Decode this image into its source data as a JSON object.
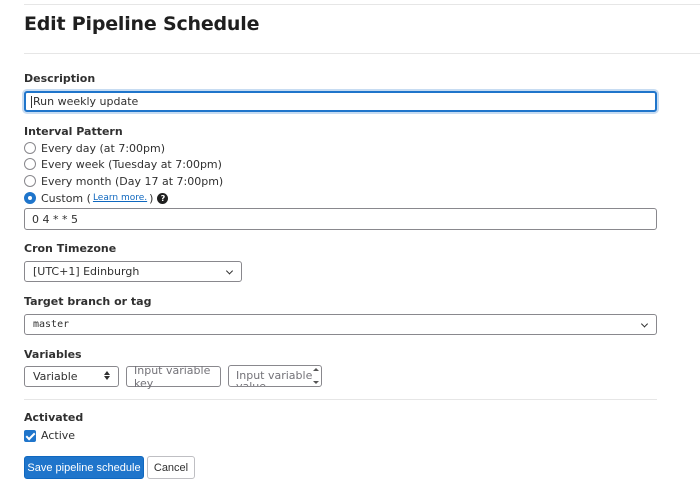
{
  "page": {
    "title": "Edit Pipeline Schedule"
  },
  "description": {
    "label": "Description",
    "value": "Run weekly update"
  },
  "interval": {
    "label": "Interval Pattern",
    "options": [
      {
        "label": "Every day (at 7:00pm)",
        "checked": false
      },
      {
        "label": "Every week (Tuesday at 7:00pm)",
        "checked": false
      },
      {
        "label": "Every month (Day 17 at 7:00pm)",
        "checked": false
      },
      {
        "label": "Custom (",
        "checked": true
      }
    ],
    "learn_more": "Learn more.",
    "custom_suffix": ")",
    "help_glyph": "?",
    "cron_value": "0 4 * * 5"
  },
  "timezone": {
    "label": "Cron Timezone",
    "value": "[UTC+1] Edinburgh"
  },
  "branch": {
    "label": "Target branch or tag",
    "value": "master"
  },
  "variables": {
    "label": "Variables",
    "type_value": "Variable",
    "key_placeholder": "Input variable key",
    "value_placeholder": "Input variable value"
  },
  "activated": {
    "label": "Activated",
    "checkbox_label": "Active",
    "checked": true
  },
  "actions": {
    "save_label": "Save pipeline schedule",
    "cancel_label": "Cancel"
  },
  "colors": {
    "primary": "#1f75cb",
    "link": "#1068bf",
    "text": "#303030"
  }
}
